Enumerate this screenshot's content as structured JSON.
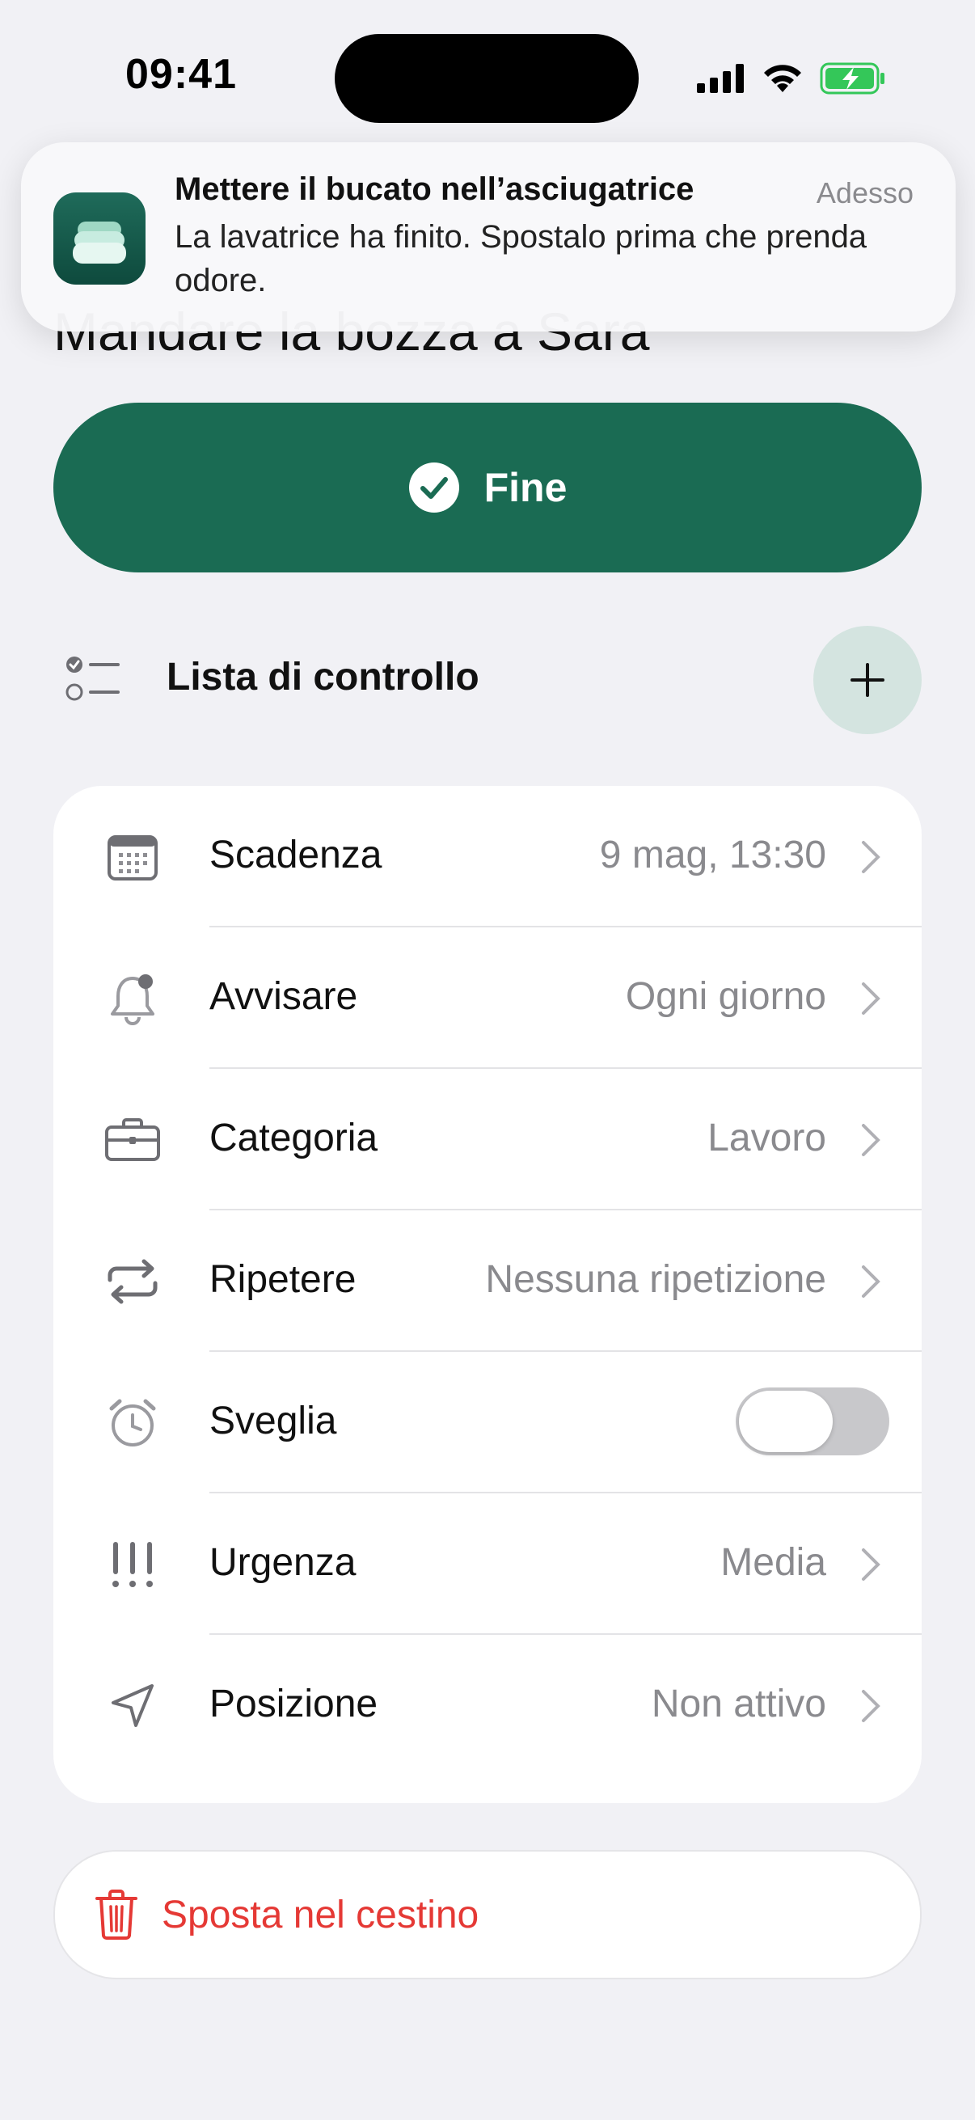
{
  "status_bar": {
    "time": "09:41"
  },
  "task": {
    "title": "Mandare la bozza a Sara"
  },
  "notification": {
    "title": "Mettere il bucato nell’asciugatrice",
    "time": "Adesso",
    "body": "La lavatrice ha finito. Spostalo prima che prenda odore."
  },
  "done_button": {
    "label": "Fine"
  },
  "checklist": {
    "label": "Lista di controllo"
  },
  "settings": {
    "rows": [
      {
        "label": "Scadenza",
        "value": "9 mag, 13:30"
      },
      {
        "label": "Avvisare",
        "value": "Ogni giorno"
      },
      {
        "label": "Categoria",
        "value": "Lavoro"
      },
      {
        "label": "Ripetere",
        "value": "Nessuna ripetizione"
      },
      {
        "label": "Sveglia",
        "toggle_on": false
      },
      {
        "label": "Urgenza",
        "value": "Media"
      },
      {
        "label": "Posizione",
        "value": "Non attivo"
      }
    ]
  },
  "trash_button": {
    "label": "Sposta nel cestino"
  },
  "colors": {
    "accent": "#1a6b53",
    "destructive": "#e53935",
    "secondary_text": "#8a8a8e"
  }
}
